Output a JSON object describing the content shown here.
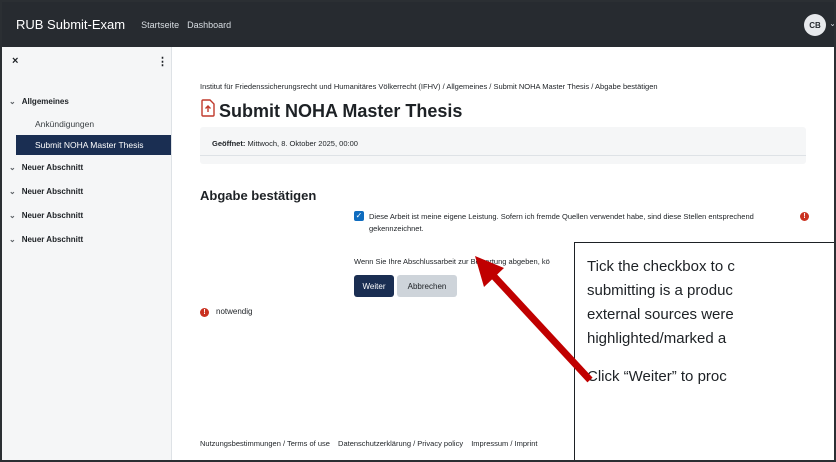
{
  "topbar": {
    "brand": "RUB Submit-Exam",
    "nav": [
      "Startseite",
      "Dashboard"
    ],
    "avatar_initials": "CB"
  },
  "sidebar": {
    "close_glyph": "×",
    "more_glyph": "⋮",
    "sections": [
      {
        "label": "Allgemeines",
        "items": [
          "Ankündigungen",
          "Submit NOHA Master Thesis"
        ],
        "active_item": "Submit NOHA Master Thesis"
      },
      {
        "label": "Neuer Abschnitt"
      },
      {
        "label": "Neuer Abschnitt"
      },
      {
        "label": "Neuer Abschnitt"
      },
      {
        "label": "Neuer Abschnitt"
      }
    ]
  },
  "main": {
    "breadcrumb": "Institut für Friedenssicherungsrecht und Humanitäres Völkerrecht (IFHV) / Allgemeines / Submit NOHA Master Thesis / Abgabe bestätigen",
    "title": "Submit NOHA Master Thesis",
    "opened_label": "Geöffnet:",
    "opened_value": "Mittwoch, 8. Oktober 2025, 00:00",
    "section_title": "Abgabe bestätigen",
    "declaration": "Diese Arbeit ist meine eigene Leistung. Sofern ich fremde Quellen verwendet habe, sind diese Stellen entsprechend gekennzeichnet.",
    "declaration_checked": true,
    "hint": "Wenn Sie Ihre Abschlussarbeit zur Bewertung abgeben, kö",
    "btn_continue": "Weiter",
    "btn_cancel": "Abbrechen",
    "required_label": "notwendig"
  },
  "footer": {
    "links": [
      "Nutzungsbestimmungen / Terms of use",
      "Datenschutzerklärung / Privacy policy",
      "Impressum / Imprint"
    ]
  },
  "callout": {
    "lines": [
      "Tick the checkbox to c",
      "submitting is a produc",
      "external sources were",
      "highlighted/marked a"
    ],
    "line2": "Click “Weiter” to proc"
  },
  "colors": {
    "topbar": "#272b30",
    "primary": "#1a2e52",
    "required": "#ca3120",
    "checkbox": "#0f6cbf",
    "arrow": "#c00000"
  }
}
